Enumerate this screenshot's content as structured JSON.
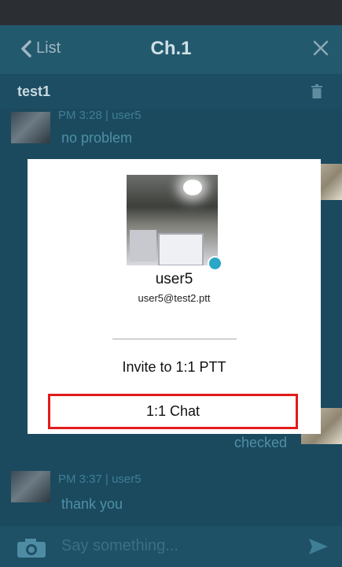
{
  "header": {
    "back_label": "List",
    "title": "Ch.1"
  },
  "channel": {
    "name": "test1"
  },
  "messages": [
    {
      "meta": "PM 3:28 | user5",
      "text": "no problem"
    },
    {
      "meta": "",
      "text": "checked"
    },
    {
      "meta": "PM 3:37 | user5",
      "text": "thank you"
    }
  ],
  "input": {
    "placeholder": "Say something..."
  },
  "modal": {
    "username": "user5",
    "email": "user5@test2.ptt",
    "invite_label": "Invite to 1:1 PTT",
    "chat_label": "1:1 Chat"
  },
  "colors": {
    "accent_online": "#2aa6c8",
    "highlight": "#e31b1b"
  }
}
